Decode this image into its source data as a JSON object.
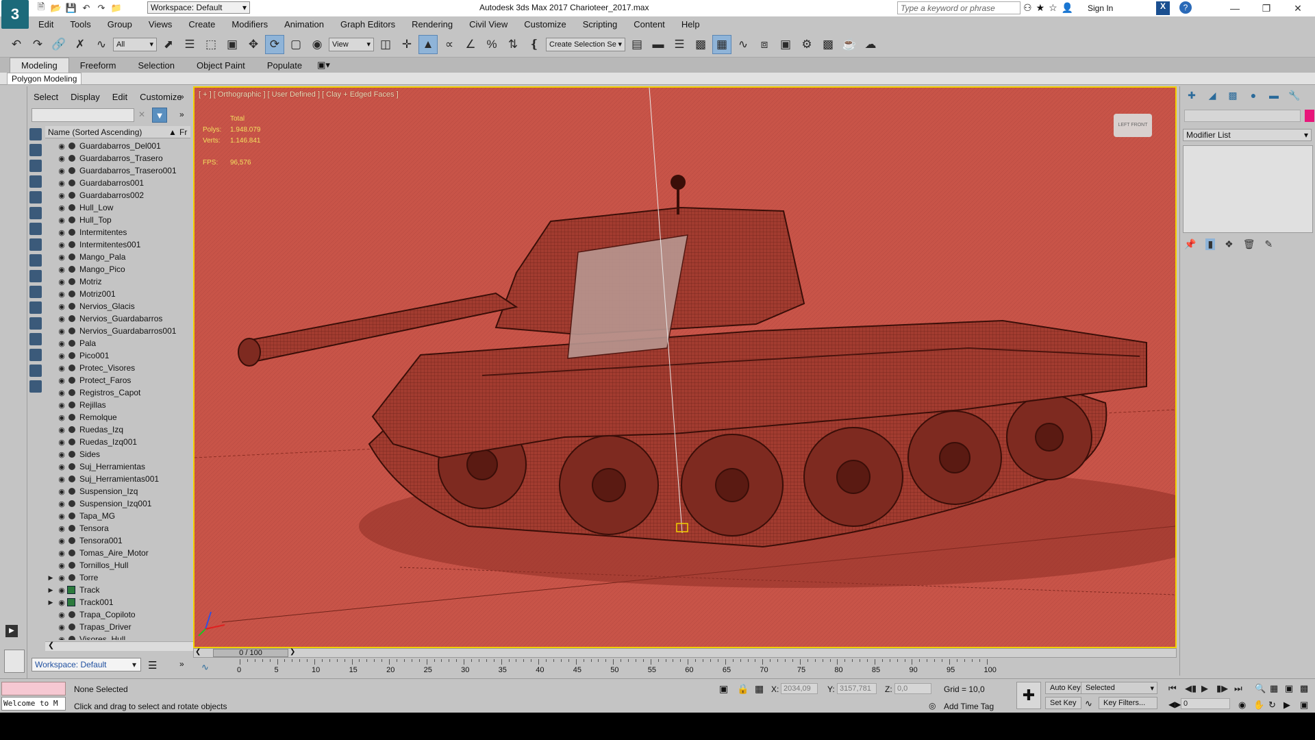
{
  "window": {
    "title": "Autodesk 3ds Max 2017    Charioteer_2017.max",
    "workspace": "Workspace: Default",
    "search_placeholder": "Type a keyword or phrase",
    "sign_in": "Sign In"
  },
  "menubar": [
    "Edit",
    "Tools",
    "Group",
    "Views",
    "Create",
    "Modifiers",
    "Animation",
    "Graph Editors",
    "Rendering",
    "Civil View",
    "Customize",
    "Scripting",
    "Content",
    "Help"
  ],
  "toolbar": {
    "filter": "All",
    "ref_coord": "View",
    "selection_set": "Create Selection Se"
  },
  "ribbon": {
    "tabs": [
      "Modeling",
      "Freeform",
      "Selection",
      "Object Paint",
      "Populate"
    ],
    "sub": "Polygon Modeling"
  },
  "explorer": {
    "menu": [
      "Select",
      "Display",
      "Edit",
      "Customize"
    ],
    "column": "Name (Sorted Ascending)",
    "column2": "Fr",
    "workspace": "Workspace: Default",
    "items": [
      {
        "name": "Guardabarros_Del001",
        "type": "mesh"
      },
      {
        "name": "Guardabarros_Trasero",
        "type": "mesh"
      },
      {
        "name": "Guardabarros_Trasero001",
        "type": "mesh"
      },
      {
        "name": "Guardabarros001",
        "type": "mesh"
      },
      {
        "name": "Guardabarros002",
        "type": "mesh"
      },
      {
        "name": "Hull_Low",
        "type": "mesh"
      },
      {
        "name": "Hull_Top",
        "type": "mesh"
      },
      {
        "name": "Intermitentes",
        "type": "mesh"
      },
      {
        "name": "Intermitentes001",
        "type": "mesh"
      },
      {
        "name": "Mango_Pala",
        "type": "mesh"
      },
      {
        "name": "Mango_Pico",
        "type": "mesh"
      },
      {
        "name": "Motriz",
        "type": "mesh"
      },
      {
        "name": "Motriz001",
        "type": "mesh"
      },
      {
        "name": "Nervios_Glacis",
        "type": "mesh"
      },
      {
        "name": "Nervios_Guardabarros",
        "type": "mesh"
      },
      {
        "name": "Nervios_Guardabarros001",
        "type": "mesh"
      },
      {
        "name": "Pala",
        "type": "mesh"
      },
      {
        "name": "Pico001",
        "type": "mesh"
      },
      {
        "name": "Protec_Visores",
        "type": "mesh"
      },
      {
        "name": "Protect_Faros",
        "type": "mesh"
      },
      {
        "name": "Registros_Capot",
        "type": "mesh"
      },
      {
        "name": "Rejillas",
        "type": "mesh"
      },
      {
        "name": "Remolque",
        "type": "mesh"
      },
      {
        "name": "Ruedas_Izq",
        "type": "mesh"
      },
      {
        "name": "Ruedas_Izq001",
        "type": "mesh"
      },
      {
        "name": "Sides",
        "type": "mesh"
      },
      {
        "name": "Suj_Herramientas",
        "type": "mesh"
      },
      {
        "name": "Suj_Herramientas001",
        "type": "mesh"
      },
      {
        "name": "Suspension_Izq",
        "type": "mesh"
      },
      {
        "name": "Suspension_Izq001",
        "type": "mesh"
      },
      {
        "name": "Tapa_MG",
        "type": "mesh"
      },
      {
        "name": "Tensora",
        "type": "mesh"
      },
      {
        "name": "Tensora001",
        "type": "mesh"
      },
      {
        "name": "Tomas_Aire_Motor",
        "type": "mesh"
      },
      {
        "name": "Tornillos_Hull",
        "type": "mesh"
      },
      {
        "name": "Torre",
        "type": "group"
      },
      {
        "name": "Track",
        "type": "track"
      },
      {
        "name": "Track001",
        "type": "track"
      },
      {
        "name": "Trapa_Copiloto",
        "type": "mesh"
      },
      {
        "name": "Trapas_Driver",
        "type": "mesh"
      },
      {
        "name": "Visores_Hull",
        "type": "mesh"
      }
    ]
  },
  "viewport": {
    "label": "[ + ] [ Orthographic ] [ User Defined ] [ Clay + Edged Faces ]",
    "stats": {
      "total": "Total",
      "polys_label": "Polys:",
      "polys": "1.948.079",
      "verts_label": "Verts:",
      "verts": "1.146.841",
      "fps_label": "FPS:",
      "fps": "96,576"
    },
    "viewcube": "LEFT  FRONT"
  },
  "command_panel": {
    "modifier_list": "Modifier List"
  },
  "timeline": {
    "frame": "0 / 100",
    "ticks": [
      "0",
      "5",
      "10",
      "15",
      "20",
      "25",
      "30",
      "35",
      "40",
      "45",
      "50",
      "55",
      "60",
      "65",
      "70",
      "75",
      "80",
      "85",
      "90",
      "95",
      "100"
    ]
  },
  "status": {
    "selection": "None Selected",
    "prompt": "Click and drag to select and rotate objects",
    "welcome": "Welcome to M",
    "x_label": "X:",
    "x": "2034,09",
    "y_label": "Y:",
    "y": "3157,781",
    "z_label": "Z:",
    "z": "0,0",
    "grid": "Grid = 10,0",
    "add_time_tag": "Add Time Tag",
    "auto_key": "Auto Key",
    "set_key": "Set Key",
    "selected": "Selected",
    "key_filters": "Key Filters...",
    "frame_field": "0"
  },
  "colors": {
    "viewport_bg": "#c85448",
    "viewport_border": "#f2d000",
    "stats_text": "#f2e060",
    "object_color": "#e8157a"
  }
}
